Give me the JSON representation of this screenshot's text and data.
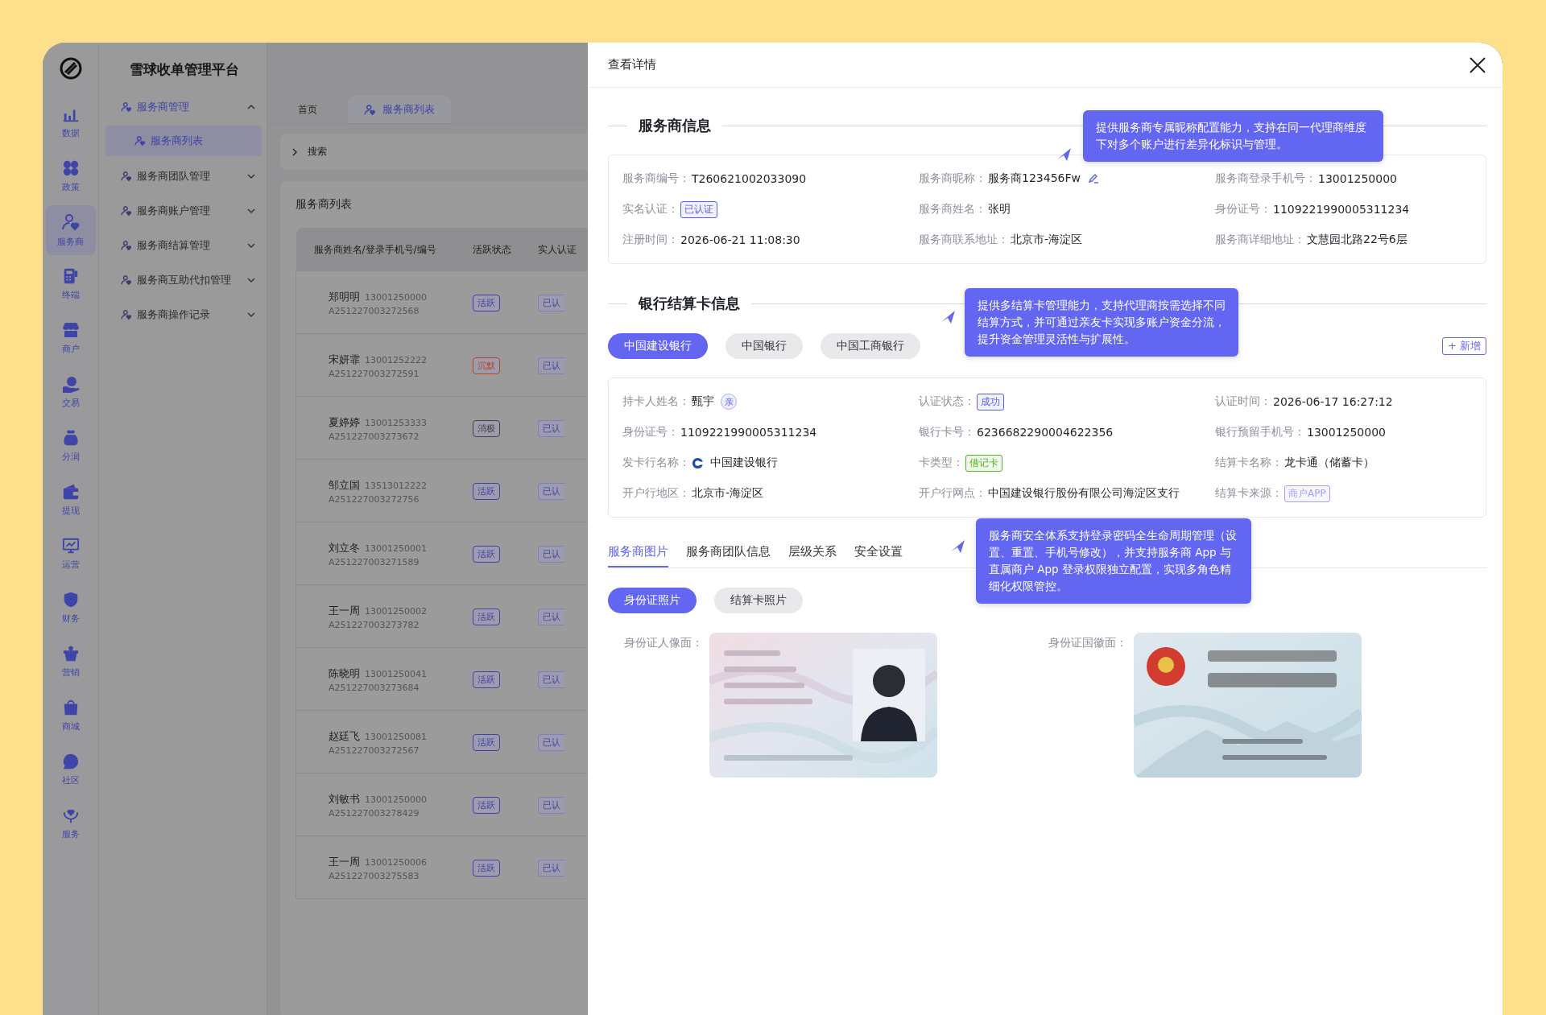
{
  "rail": [
    {
      "label": "数据",
      "selected": false
    },
    {
      "label": "政策",
      "selected": false
    },
    {
      "label": "服务商",
      "selected": true
    },
    {
      "label": "终端",
      "selected": false
    },
    {
      "label": "商户",
      "selected": false
    },
    {
      "label": "交易",
      "selected": false
    },
    {
      "label": "分润",
      "selected": false
    },
    {
      "label": "提现",
      "selected": false
    },
    {
      "label": "运营",
      "selected": false
    },
    {
      "label": "财务",
      "selected": false
    },
    {
      "label": "营销",
      "selected": false
    },
    {
      "label": "商城",
      "selected": false
    },
    {
      "label": "社区",
      "selected": false
    },
    {
      "label": "服务",
      "selected": false
    }
  ],
  "nav": {
    "title": "雪球收单管理平台",
    "groups": [
      {
        "label": "服务商管理",
        "expanded": true,
        "children": [
          {
            "label": "服务商列表",
            "selected": true
          }
        ]
      },
      {
        "label": "服务商团队管理",
        "expanded": false
      },
      {
        "label": "服务商账户管理",
        "expanded": false
      },
      {
        "label": "服务商结算管理",
        "expanded": false
      },
      {
        "label": "服务商互助代扣管理",
        "expanded": false
      },
      {
        "label": "服务商操作记录",
        "expanded": false
      }
    ]
  },
  "page_tabs": [
    {
      "label": "首页",
      "selected": false
    },
    {
      "label": "服务商列表",
      "selected": true
    }
  ],
  "search": {
    "label": "搜索"
  },
  "list": {
    "title": "服务商列表",
    "columns": [
      "服务商姓名/登录手机号/编号",
      "活跃状态",
      "实人认证"
    ],
    "rows": [
      {
        "name": "郑明明",
        "phone": "13001250000",
        "code": "A251227003272568",
        "activity": "活跃",
        "color": "#3d41a8",
        "cert": "已认"
      },
      {
        "name": "宋妍霏",
        "phone": "13001252222",
        "code": "A251227003272591",
        "activity": "沉默",
        "color": "#b8451e",
        "cert": "已认"
      },
      {
        "name": "夏婷婷",
        "phone": "13001253333",
        "code": "A251227003273672",
        "activity": "消极",
        "color": "#444444",
        "cert": "已认"
      },
      {
        "name": "邹立国",
        "phone": "13513012222",
        "code": "A251227003272756",
        "activity": "活跃",
        "color": "#3d41a8",
        "cert": "已认"
      },
      {
        "name": "刘立冬",
        "phone": "13001250001",
        "code": "A251227003271589",
        "activity": "活跃",
        "color": "#3d41a8",
        "cert": "已认"
      },
      {
        "name": "王一周",
        "phone": "13001250002",
        "code": "A251227003273782",
        "activity": "活跃",
        "color": "#3d41a8",
        "cert": "已认"
      },
      {
        "name": "陈晓明",
        "phone": "13001250041",
        "code": "A251227003273684",
        "activity": "活跃",
        "color": "#3d41a8",
        "cert": "已认"
      },
      {
        "name": "赵廷飞",
        "phone": "13001250081",
        "code": "A251227003272567",
        "activity": "活跃",
        "color": "#3d41a8",
        "cert": "已认"
      },
      {
        "name": "刘敏书",
        "phone": "13001250000",
        "code": "A251227003278429",
        "activity": "活跃",
        "color": "#3d41a8",
        "cert": "已认"
      },
      {
        "name": "王一周",
        "phone": "13001250006",
        "code": "A251227003275583",
        "activity": "活跃",
        "color": "#3d41a8",
        "cert": "已认"
      }
    ]
  },
  "drawer": {
    "title": "查看详情",
    "provider_info": {
      "title": "服务商信息",
      "fields": [
        {
          "label": "服务商编号：",
          "value": "T260621002033090",
          "kind": "text"
        },
        {
          "label": "服务商昵称：",
          "value": "服务商123456Fw",
          "kind": "editable"
        },
        {
          "label": "服务商登录手机号：",
          "value": "13001250000",
          "kind": "text"
        },
        {
          "label": "实名认证：",
          "value": "已认证",
          "kind": "tag",
          "color": "#5b5fe6"
        },
        {
          "label": "服务商姓名：",
          "value": "张明",
          "kind": "text"
        },
        {
          "label": "身份证号：",
          "value": "1109221990005311234",
          "kind": "text"
        },
        {
          "label": "注册时间：",
          "value": "2026-06-21 11:08:30",
          "kind": "text"
        },
        {
          "label": "服务商联系地址：",
          "value": "北京市-海淀区",
          "kind": "text"
        },
        {
          "label": "服务商详细地址：",
          "value": "文慧园北路22号6层",
          "kind": "text"
        }
      ]
    },
    "bank_info": {
      "title": "银行结算卡信息",
      "tabs": [
        {
          "label": "中国建设银行",
          "selected": true
        },
        {
          "label": "中国银行",
          "selected": false
        },
        {
          "label": "中国工商银行",
          "selected": false
        }
      ],
      "add_button": "+ 新增",
      "fields": [
        {
          "label": "持卡人姓名：",
          "value": "甄宇",
          "kind": "badge",
          "badge": "亲"
        },
        {
          "label": "认证状态：",
          "value": "成功",
          "kind": "tag",
          "color": "#5b5fe6"
        },
        {
          "label": "认证时间：",
          "value": "2026-06-17 16:27:12",
          "kind": "text"
        },
        {
          "label": "身份证号：",
          "value": "1109221990005311234",
          "kind": "text"
        },
        {
          "label": "银行卡号：",
          "value": "6236682290004622356",
          "kind": "text"
        },
        {
          "label": "银行预留手机号：",
          "value": "13001250000",
          "kind": "text"
        },
        {
          "label": "发卡行名称：",
          "value": "中国建设银行",
          "kind": "bank"
        },
        {
          "label": "卡类型：",
          "value": "借记卡",
          "kind": "tag",
          "color": "#52b41a"
        },
        {
          "label": "结算卡名称：",
          "value": "龙卡通（储蓄卡）",
          "kind": "text"
        },
        {
          "label": "开户行地区：",
          "value": "北京市-海淀区",
          "kind": "text"
        },
        {
          "label": "开户行网点：",
          "value": "中国建设银行股份有限公司海淀区支行",
          "kind": "text"
        },
        {
          "label": "结算卡来源：",
          "value": "商户APP",
          "kind": "tag",
          "color": "#9fa3f2"
        }
      ]
    },
    "detail_tabs": [
      {
        "label": "服务商图片",
        "selected": true
      },
      {
        "label": "服务商团队信息",
        "selected": false
      },
      {
        "label": "层级关系",
        "selected": false
      },
      {
        "label": "安全设置",
        "selected": false
      }
    ],
    "photo_tabs": [
      {
        "label": "身份证照片",
        "selected": true
      },
      {
        "label": "结算卡照片",
        "selected": false
      }
    ],
    "photos": [
      {
        "label": "身份证人像面：",
        "kind": "picture"
      },
      {
        "label": "身份证国徽面：",
        "kind": "picture"
      }
    ]
  },
  "tooltips": [
    {
      "text": "提供服务商专属昵称配置能力，支持在同一代理商维度下对多个账户进行差异化标识与管理。"
    },
    {
      "text": "提供多结算卡管理能力，支持代理商按需选择不同结算方式，并可通过亲友卡实现多账户资金分流，提升资金管理灵活性与扩展性。"
    },
    {
      "text": "服务商安全体系支持登录密码全生命周期管理（设置、重置、手机号修改），并支持服务商 App 与直属商户 App 登录权限独立配置，实现多角色精细化权限管控。"
    }
  ]
}
